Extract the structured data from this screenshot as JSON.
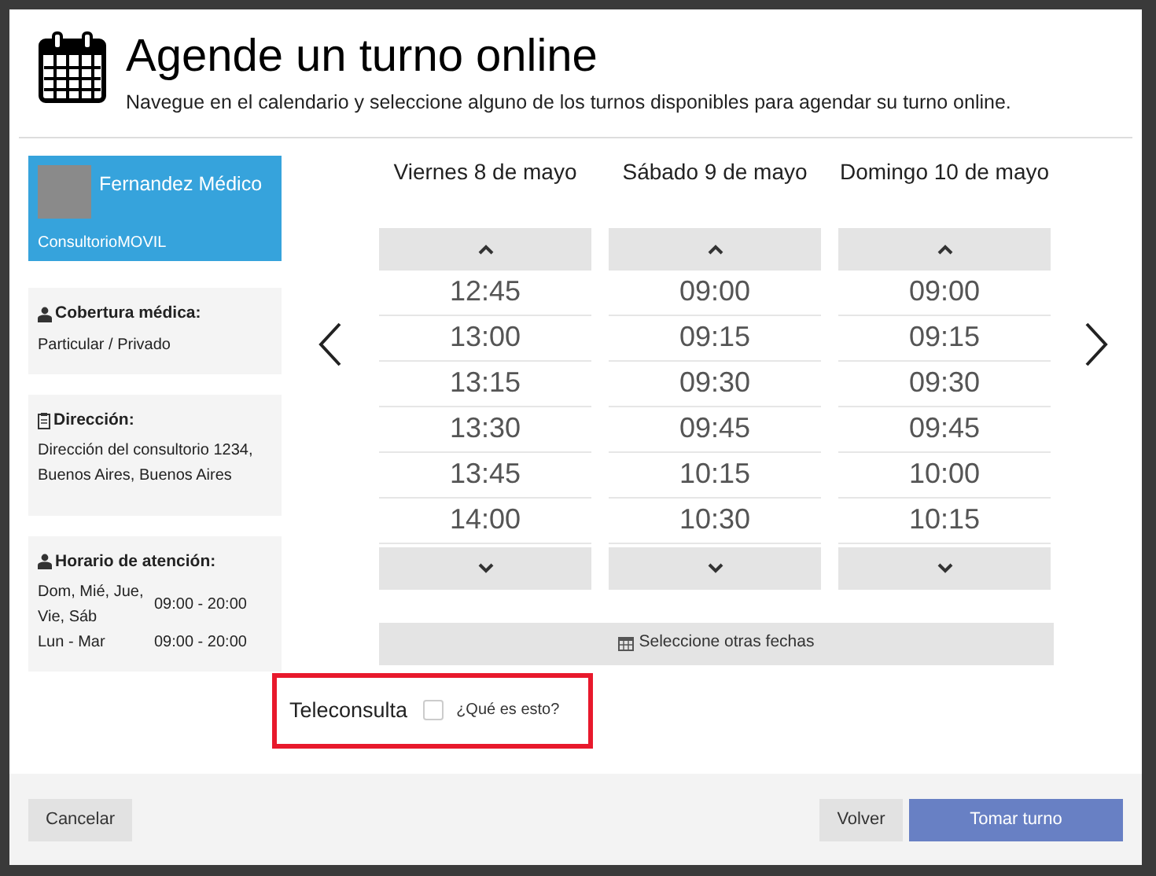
{
  "header": {
    "title": "Agende un turno online",
    "subtitle": "Navegue en el calendario y seleccione alguno de los turnos disponibles para agendar su turno online."
  },
  "professional": {
    "name": "Fernandez Médico",
    "office": "ConsultorioMOVIL"
  },
  "info_cards": [
    {
      "kind": "text",
      "label": "Cobertura médica:",
      "lines": [
        "Particular / Privado"
      ]
    },
    {
      "kind": "text",
      "label": "Dirección:",
      "lines": [
        "Dirección del consultorio 1234, Buenos Aires, Buenos Aires"
      ]
    },
    {
      "kind": "schedule",
      "label": "Horario de atención:",
      "rows": [
        {
          "days": "Dom, Mié, Jue, Vie, Sáb",
          "hours": "09:00 - 20:00"
        },
        {
          "days": "Lun - Mar",
          "hours": "09:00 - 20:00"
        }
      ]
    }
  ],
  "days": [
    {
      "title": "Viernes 8 de mayo",
      "times": [
        "12:45",
        "13:00",
        "13:15",
        "13:30",
        "13:45",
        "14:00"
      ]
    },
    {
      "title": "Sábado 9 de mayo",
      "times": [
        "09:00",
        "09:15",
        "09:30",
        "09:45",
        "10:15",
        "10:30"
      ]
    },
    {
      "title": "Domingo 10 de mayo",
      "times": [
        "09:00",
        "09:15",
        "09:30",
        "09:45",
        "10:00",
        "10:15"
      ]
    }
  ],
  "other_dates_button": "Seleccione otras fechas",
  "teleconsulta": {
    "label": "Teleconsulta",
    "checked": false,
    "help_link": "¿Qué es esto?"
  },
  "footer": {
    "cancel": "Cancelar",
    "back": "Volver",
    "submit": "Tomar turno"
  }
}
